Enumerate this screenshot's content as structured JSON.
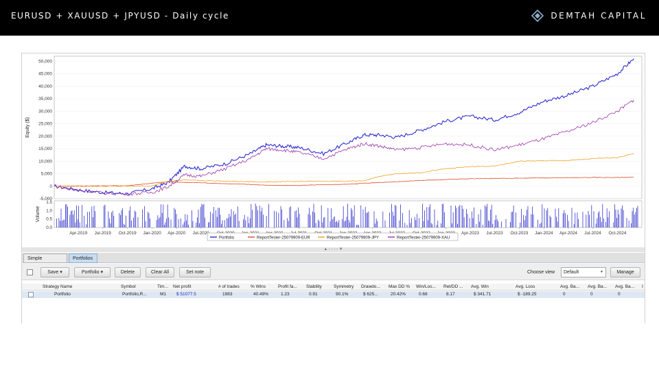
{
  "slide": {
    "title": "EURUSD + XAUUSD + JPYUSD - Daily cycle",
    "brand": "DEMTAH CAPITAL",
    "brand_icon": "diamond-logo-icon"
  },
  "chart_data": {
    "type": "line",
    "ylabel": "Equity ($)",
    "ylim": [
      -5000,
      52000
    ],
    "y_ticks": [
      "50,000",
      "45,000",
      "40,000",
      "35,000",
      "30,000",
      "25,000",
      "20,000",
      "15,000",
      "10,000",
      "5,000",
      "0",
      "-5,000"
    ],
    "x_ticks": [
      "Apr-2019",
      "Jul-2019",
      "Oct-2019",
      "Jan-2020",
      "Apr-2020",
      "Jul-2020",
      "Oct-2020",
      "Jan-2021",
      "Apr-2021",
      "Jul-2021",
      "Oct-2021",
      "Jan-2022",
      "Apr-2022",
      "Jul-2022",
      "Oct-2022",
      "Jan-2023",
      "Apr-2023",
      "Jul-2023",
      "Oct-2023",
      "Jan-2024",
      "Apr-2024",
      "Jul-2024",
      "Oct-2024"
    ],
    "x": [
      "2019-01",
      "2019-04",
      "2019-07",
      "2019-10",
      "2020-01",
      "2020-03",
      "2020-05",
      "2020-07",
      "2020-10",
      "2021-01",
      "2021-03",
      "2021-05",
      "2021-07",
      "2021-10",
      "2022-01",
      "2022-03",
      "2022-05",
      "2022-07",
      "2022-10",
      "2023-01",
      "2023-04",
      "2023-07",
      "2023-10",
      "2024-01",
      "2024-04",
      "2024-07",
      "2024-10",
      "2024-12"
    ],
    "series": [
      {
        "name": "Portfolio",
        "color": "#2a2ad4",
        "values": [
          0,
          -1500,
          -2500,
          -3000,
          -1000,
          1500,
          8000,
          7000,
          9000,
          13000,
          16500,
          16000,
          15500,
          13000,
          17500,
          20500,
          20500,
          19500,
          22500,
          26000,
          28000,
          26500,
          29500,
          34000,
          36500,
          40000,
          45000,
          51000
        ]
      },
      {
        "name": "ReportTester-25079909-EUR",
        "color": "#d84a2a",
        "values": [
          0,
          100,
          150,
          200,
          1200,
          1800,
          1500,
          1400,
          1000,
          700,
          400,
          300,
          300,
          600,
          800,
          1200,
          1500,
          1800,
          2300,
          2700,
          3000,
          3100,
          3200,
          3300,
          3400,
          3500,
          3500,
          3600
        ]
      },
      {
        "name": "ReportTester-25079909-JPY",
        "color": "#f0a020",
        "values": [
          0,
          0,
          0,
          0,
          100,
          2000,
          2500,
          2300,
          2000,
          1800,
          1700,
          1800,
          1900,
          2000,
          2000,
          2200,
          4000,
          5000,
          5500,
          7000,
          7800,
          8000,
          10000,
          10200,
          10300,
          11000,
          11500,
          13000
        ]
      },
      {
        "name": "ReportTester-25079909-XAU",
        "color": "#9a30a8",
        "values": [
          0,
          -1500,
          -2700,
          -3100,
          -2500,
          -200,
          4500,
          4000,
          7000,
          11000,
          15000,
          14500,
          13500,
          11000,
          15000,
          17000,
          16000,
          14500,
          15500,
          17000,
          16500,
          14500,
          16500,
          19000,
          22000,
          25500,
          30000,
          34500
        ]
      }
    ],
    "volume": {
      "ylabel": "Volume",
      "y_ticks": [
        "1.5",
        "1.0",
        "0.5",
        "0.0"
      ],
      "ylim": [
        0,
        1.5
      ]
    },
    "legend_position": "bottom-center",
    "grid": true
  },
  "ui": {
    "splitter_label": "▲ - - - - ▼",
    "tabs": [
      {
        "label": "Simple strategies",
        "active": false
      },
      {
        "label": "Portfolios",
        "active": true
      }
    ],
    "toolbar": {
      "save_label": "Save",
      "portfolio_label": "Portfolio",
      "delete_label": "Delete",
      "clear_all_label": "Clear All",
      "set_note_label": "Set note",
      "choose_view_label": "Choose view",
      "view_value": "Default",
      "manage_label": "Manage"
    },
    "table": {
      "columns": [
        "Strategy Name",
        "Symbol",
        "Tim...",
        "Net profit",
        "# of trades",
        "% Wins",
        "Profit fa...",
        "Stability",
        "Symmetry",
        "Drawdo...",
        "Max DD %",
        "Win/Los...",
        "Ret/DD ...",
        "Avg. Win",
        "Avg. Loss",
        "Avg. Ba...",
        "Avg. Ba...",
        "Avg. Ba...",
        "I"
      ],
      "rows": [
        [
          "Portfolio",
          "Portfolio,R...",
          "M1",
          "$ 51077.5",
          "1983",
          "40.49%",
          "1.23",
          "0.91",
          "90.1%",
          "$ 625...",
          "20.42%",
          "0.68",
          "8.17",
          "$ 341.71",
          "$ -189.25",
          "0",
          "0",
          "0",
          ""
        ]
      ]
    }
  }
}
